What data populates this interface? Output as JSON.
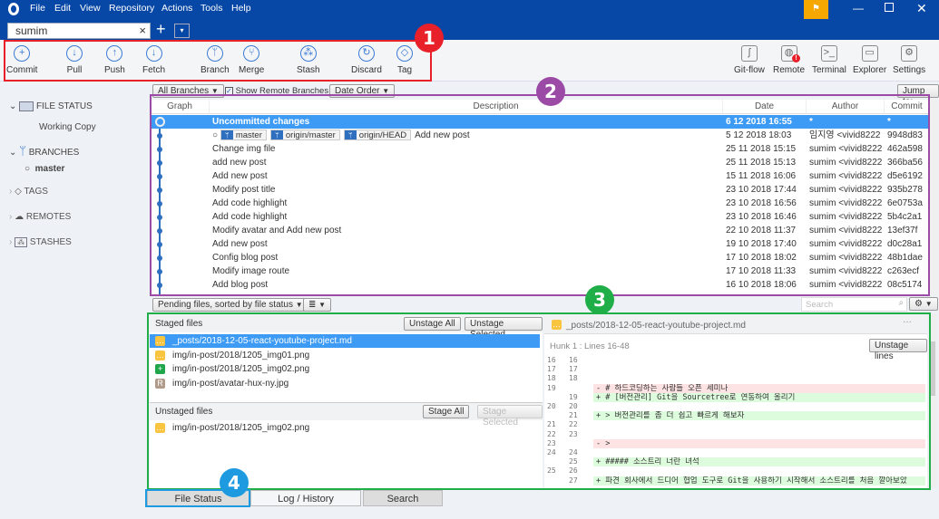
{
  "menu": [
    "File",
    "Edit",
    "View",
    "Repository",
    "Actions",
    "Tools",
    "Help"
  ],
  "repo_tab": "sumim",
  "toolbar_left": [
    {
      "label": "Commit",
      "icon": "plus-circle-icon",
      "g": "+"
    },
    {
      "label": "Pull",
      "icon": "arrow-down-circle-icon",
      "g": "↓"
    },
    {
      "label": "Push",
      "icon": "arrow-up-circle-icon",
      "g": "↑"
    },
    {
      "label": "Fetch",
      "icon": "fetch-icon",
      "g": "↓"
    },
    {
      "label": "Branch",
      "icon": "branch-icon",
      "g": "ᛘ"
    },
    {
      "label": "Merge",
      "icon": "merge-icon",
      "g": "⑂"
    },
    {
      "label": "Stash",
      "icon": "stash-icon",
      "g": "⁂"
    },
    {
      "label": "Discard",
      "icon": "discard-icon",
      "g": "↻"
    },
    {
      "label": "Tag",
      "icon": "tag-icon",
      "g": "◇"
    }
  ],
  "toolbar_right": [
    {
      "label": "Git-flow",
      "icon": "git-flow-icon",
      "g": "∫"
    },
    {
      "label": "Remote",
      "icon": "globe-icon",
      "g": "◍"
    },
    {
      "label": "Terminal",
      "icon": "terminal-icon",
      "g": ">_"
    },
    {
      "label": "Explorer",
      "icon": "folder-icon",
      "g": "▭"
    },
    {
      "label": "Settings",
      "icon": "gear-icon",
      "g": "⚙"
    }
  ],
  "sidebar": {
    "file_status": "FILE STATUS",
    "working_copy": "Working Copy",
    "branches": "BRANCHES",
    "master": "master",
    "tags": "TAGS",
    "remotes": "REMOTES",
    "stashes": "STASHES"
  },
  "filters": {
    "branches": "All Branches",
    "show_remote": "Show Remote Branches",
    "order": "Date Order",
    "jump": "Jump to:"
  },
  "columns": {
    "graph": "Graph",
    "description": "Description",
    "date": "Date",
    "author": "Author",
    "commit": "Commit"
  },
  "commits": [
    {
      "desc": "Uncommitted changes",
      "date": "6 12 2018 16:55",
      "author": "*",
      "commit": "*"
    },
    {
      "desc": "Add new post",
      "tags": [
        "master",
        "origin/master",
        "origin/HEAD"
      ],
      "date": "5 12 2018 18:03",
      "author": "임지영 <vivid8222",
      "commit": "9948d83"
    },
    {
      "desc": "Change img file",
      "date": "25 11 2018 15:15",
      "author": "sumim <vivid8222",
      "commit": "462a598"
    },
    {
      "desc": "add new post",
      "date": "25 11 2018 15:13",
      "author": "sumim <vivid8222",
      "commit": "366ba56"
    },
    {
      "desc": "Add new post",
      "date": "15 11 2018 16:06",
      "author": "sumim <vivid8222",
      "commit": "d5e6192"
    },
    {
      "desc": "Modify post title",
      "date": "23 10 2018 17:44",
      "author": "sumim <vivid8222",
      "commit": "935b278"
    },
    {
      "desc": "Add code highlight",
      "date": "23 10 2018 16:56",
      "author": "sumim <vivid8222",
      "commit": "6e0753a"
    },
    {
      "desc": "Add code highlight",
      "date": "23 10 2018 16:46",
      "author": "sumim <vivid8222",
      "commit": "5b4c2a1"
    },
    {
      "desc": "Modify avatar and Add new post",
      "date": "22 10 2018 11:37",
      "author": "sumim <vivid8222",
      "commit": "13ef37f"
    },
    {
      "desc": "Add new post",
      "date": "19 10 2018 17:40",
      "author": "sumim <vivid8222",
      "commit": "d0c28a1"
    },
    {
      "desc": "Config blog post",
      "date": "17 10 2018 18:02",
      "author": "sumim <vivid8222",
      "commit": "48b1dae"
    },
    {
      "desc": "Modify image route",
      "date": "17 10 2018 11:33",
      "author": "sumim <vivid8222",
      "commit": "c263ecf"
    },
    {
      "desc": "Add blog post",
      "date": "16 10 2018 18:06",
      "author": "sumim <vivid8222",
      "commit": "08c5174"
    }
  ],
  "pending": {
    "sort": "Pending files, sorted by file status",
    "search_placeholder": "Search"
  },
  "staged": {
    "title": "Staged files",
    "unstage_all": "Unstage All",
    "unstage_selected": "Unstage Selected",
    "files": [
      {
        "name": "_posts/2018-12-05-react-youtube-project.md",
        "status": "modified"
      },
      {
        "name": "img/in-post/2018/1205_img01.png",
        "status": "modified"
      },
      {
        "name": "img/in-post/2018/1205_img02.png",
        "status": "added"
      },
      {
        "name": "img/in-post/avatar-hux-ny.jpg",
        "status": "renamed"
      }
    ]
  },
  "unstaged": {
    "title": "Unstaged files",
    "stage_all": "Stage All",
    "stage_selected": "Stage Selected",
    "files": [
      {
        "name": "img/in-post/2018/1205_img02.png",
        "status": "modified"
      }
    ]
  },
  "diff": {
    "file": "_posts/2018-12-05-react-youtube-project.md",
    "hunk": "Hunk 1 : Lines 16-48",
    "unstage_lines": "Unstage lines",
    "lines": [
      [
        "16",
        "16",
        "ctx",
        ""
      ],
      [
        "17",
        "17",
        "ctx",
        ""
      ],
      [
        "18",
        "18",
        "ctx",
        ""
      ],
      [
        "19",
        "",
        "del",
        "- # 하드코딩하는 사람들 오픈 세미나"
      ],
      [
        "",
        "19",
        "add",
        "+ # [버전관리] Git을 Sourcetree로 연동하여 올리기"
      ],
      [
        "20",
        "20",
        "ctx",
        ""
      ],
      [
        "",
        "21",
        "add",
        "+ >  버전관리를 좀 더 쉽고 빠르게 해보자"
      ],
      [
        "21",
        "22",
        "ctx",
        ""
      ],
      [
        "22",
        "23",
        "ctx",
        ""
      ],
      [
        "23",
        "",
        "del",
        "- >"
      ],
      [
        "24",
        "24",
        "ctx",
        ""
      ],
      [
        "",
        "25",
        "add",
        "+ ##### 소스트리 너란 녀석"
      ],
      [
        "25",
        "26",
        "ctx",
        ""
      ],
      [
        "",
        "27",
        "add",
        "+ 파견 회사에서 드디어 협업 도구로 Git을 사용하기 시작해서 소스트리를 처음 깔아보았"
      ]
    ]
  },
  "bottom_tabs": [
    "File Status",
    "Log / History",
    "Search"
  ],
  "annotations": [
    "1",
    "2",
    "3",
    "4"
  ],
  "colors": {
    "titlebar": "#0747a6",
    "selection": "#3d9bf5",
    "anno1": "#e8202a",
    "anno2": "#9b4aa6",
    "anno3": "#1fae48",
    "anno4": "#1e9be0"
  }
}
